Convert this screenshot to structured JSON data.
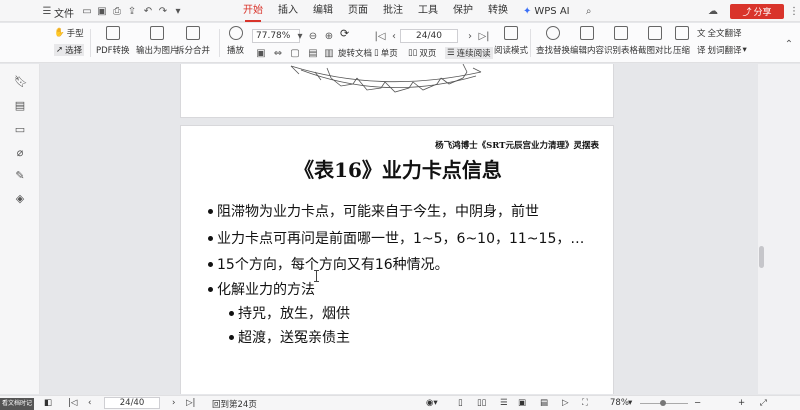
{
  "menubar": {
    "file_label": "文件",
    "tabs": [
      "开始",
      "插入",
      "编辑",
      "页面",
      "批注",
      "工具",
      "保护",
      "转换"
    ],
    "active_tab": "开始",
    "wps_ai_label": "WPS AI",
    "share_label": "分享"
  },
  "ribbon": {
    "hand_label": "手型",
    "select_label": "选择",
    "pdf_convert_label": "PDF转换",
    "export_image_label": "输出为图片",
    "split_merge_label": "拆分合并",
    "play_label": "播放",
    "zoom_value": "77.78%",
    "rotate_label": "旋转文档",
    "single_page_label": "单页",
    "double_page_label": "双页",
    "continuous_label": "连续阅读",
    "read_mode_label": "阅读模式",
    "page_value": "24/40",
    "find_replace_label": "查找替换",
    "edit_content_label": "编辑内容",
    "recognize_table_label": "识别表格",
    "screenshot_compare_label": "截图对比",
    "compress_label": "压缩",
    "full_translate_label": "全文翻译",
    "word_translate_label": "划词翻译"
  },
  "page": {
    "header": "杨飞鸿博士《SRT元辰宫业力清理》灵摆表",
    "title": "《表16》业力卡点信息",
    "bullets": [
      "阻滞物为业力卡点，可能来自于今生，中阴身，前世",
      "业力卡点可再问是前面哪一世，1~5，6~10，11~15，…",
      "15个方向，每个方向又有16种情况。",
      "化解业力的方法"
    ],
    "sub_bullets": [
      "持咒，放生，烟供",
      "超渡，送冤亲债主"
    ]
  },
  "statusbar": {
    "page_value": "24/40",
    "return_label": "回到第24页",
    "zoom_label": "78%",
    "thumbnail_text": "看文档时记录笔记"
  }
}
